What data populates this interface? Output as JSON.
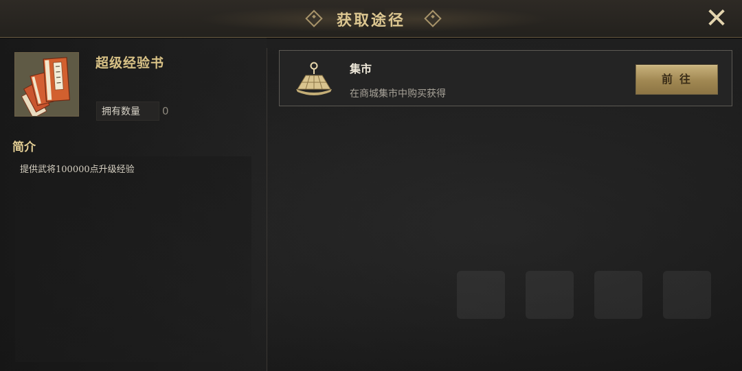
{
  "header": {
    "title": "获取途径",
    "close_icon": "close-icon"
  },
  "item": {
    "name": "超级经验书",
    "icon": "book-stack-icon",
    "owned_label": "拥有数量",
    "owned_value": "0"
  },
  "intro": {
    "heading": "简介",
    "text": "提供武将100000点升级经验"
  },
  "sources": [
    {
      "name": "集市",
      "icon": "market-icon",
      "description": "在商城集市中购买获得",
      "button_label": "前往"
    }
  ],
  "colors": {
    "title_gold": "#dcc690",
    "button_gold": "#b39a62",
    "background": "#1b1b1b"
  }
}
